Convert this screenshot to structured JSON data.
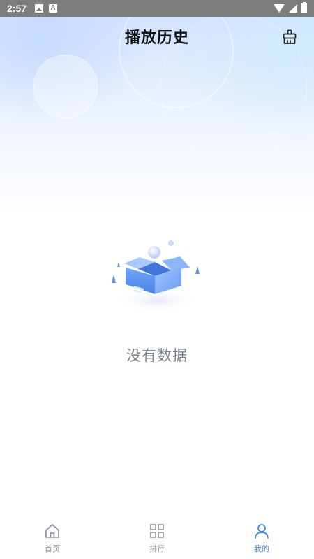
{
  "status_bar": {
    "time": "2:57",
    "icons": [
      "image-icon",
      "a-icon",
      "wifi-icon",
      "signal-icon",
      "battery-icon"
    ]
  },
  "header": {
    "title": "播放历史",
    "action_icon": "broom-clear-icon"
  },
  "empty_state": {
    "illustration": "empty-box-icon",
    "message": "没有数据"
  },
  "bottom_nav": {
    "active_index": 2,
    "accent_color": "#3a86e8",
    "inactive_color": "#8a8f99",
    "items": [
      {
        "label": "首页",
        "icon": "home-icon"
      },
      {
        "label": "排行",
        "icon": "grid-icon"
      },
      {
        "label": "我的",
        "icon": "user-icon"
      }
    ]
  }
}
